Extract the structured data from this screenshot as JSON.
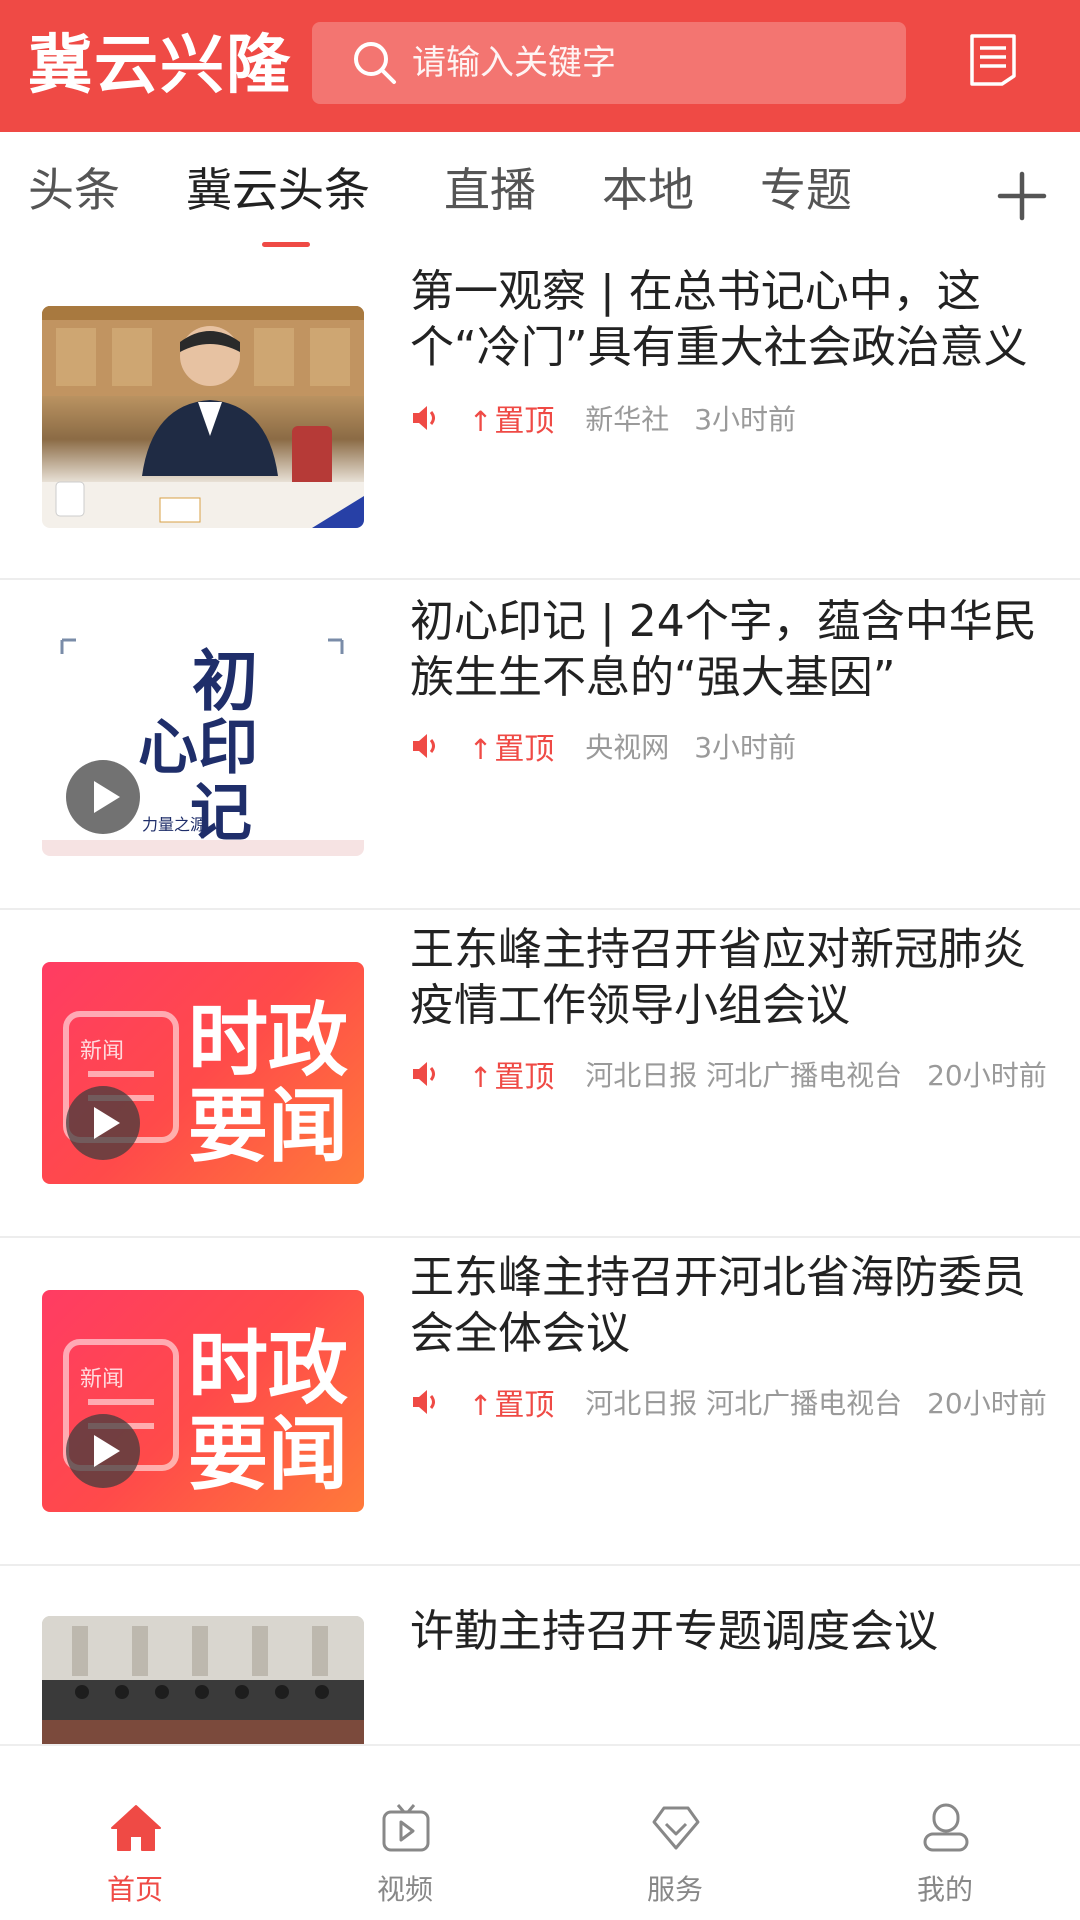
{
  "header": {
    "logo": "冀云兴隆",
    "search_placeholder": "请输入关键字",
    "search_icon": "search-icon",
    "menu_icon": "news-list-icon"
  },
  "tabs": [
    {
      "label": "头条",
      "active": false
    },
    {
      "label": "冀云头条",
      "active": true
    },
    {
      "label": "直播",
      "active": false
    },
    {
      "label": "本地",
      "active": false
    },
    {
      "label": "专题",
      "active": false
    }
  ],
  "tab_more_icon": "plus-icon",
  "articles": [
    {
      "title": "第一观察 | 在总书记心中，这个“冷门”具有重大社会政治意义",
      "pin_label": "置顶",
      "source": "新华社",
      "time": "3小时前",
      "has_video": false
    },
    {
      "title": "初心印记 | 24个字，蕴含中华民族生生不息的“强大基因”",
      "pin_label": "置顶",
      "source": "央视网",
      "time": "3小时前",
      "has_video": true,
      "thumb_text": {
        "line1": "初",
        "line2": "心印",
        "line3": "记",
        "small": "力量之源"
      }
    },
    {
      "title": "王东峰主持召开省应对新冠肺炎疫情工作领导小组会议",
      "pin_label": "置顶",
      "source": "河北日报 河北广播电视台",
      "time": "20小时前",
      "has_video": true,
      "thumb_text": {
        "tag": "新闻",
        "big": "时政要闻"
      }
    },
    {
      "title": "王东峰主持召开河北省海防委员会全体会议",
      "pin_label": "置顶",
      "source": "河北日报 河北广播电视台",
      "time": "20小时前",
      "has_video": true,
      "thumb_text": {
        "tag": "新闻",
        "big": "时政要闻"
      }
    },
    {
      "title": "许勤主持召开专题调度会议",
      "has_video": false
    }
  ],
  "bottom_nav": [
    {
      "label": "首页",
      "icon": "home-icon",
      "active": true
    },
    {
      "label": "视频",
      "icon": "tv-play-icon",
      "active": false
    },
    {
      "label": "服务",
      "icon": "diamond-icon",
      "active": false
    },
    {
      "label": "我的",
      "icon": "user-icon",
      "active": false
    }
  ],
  "colors": {
    "brand": "#ef4a45",
    "text": "#222222",
    "meta": "#9a9a9a",
    "divider": "#ededed"
  }
}
